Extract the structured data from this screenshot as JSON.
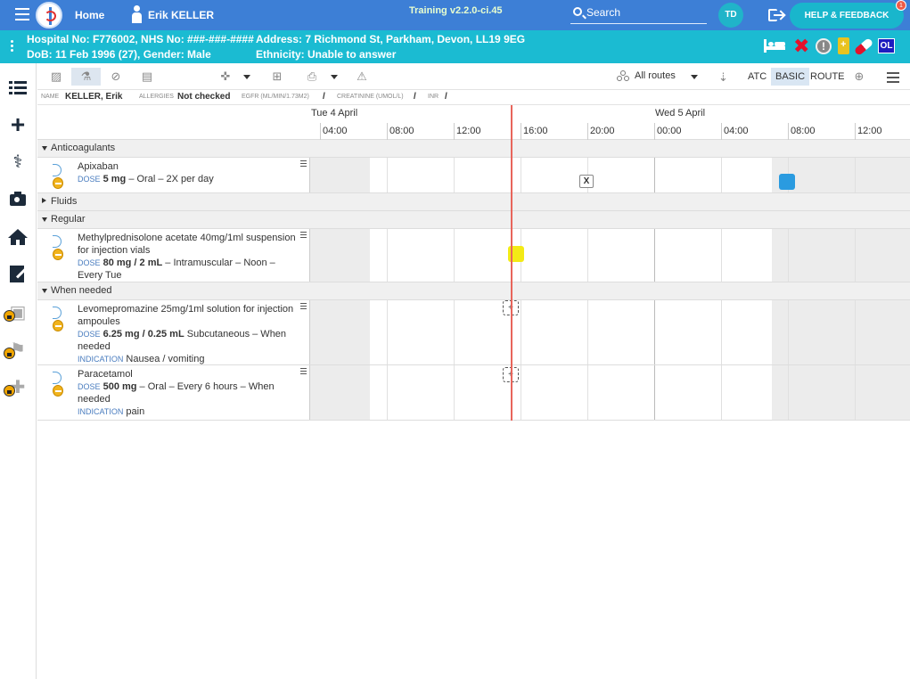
{
  "topbar": {
    "home_label": "Home",
    "user_name": "Erik KELLER",
    "training": "Training v2.2.0-ci.45",
    "search_label": "Search",
    "initials": "TD",
    "help_label": "HELP & FEEDBACK",
    "notification_count": "1"
  },
  "patient": {
    "hospital_line": "Hospital No: F776002, NHS No: ###-###-####",
    "dob_line": "DoB: 11 Feb 1996 (27), Gender: Male",
    "address_line": "Address: 7 Richmond St, Parkham, Devon, LL19 9EG",
    "ethnicity_line": "Ethnicity: Unable to answer",
    "ol_badge": "OL"
  },
  "toolbar": {
    "routes_label": "All routes",
    "atc_label": "ATC",
    "basic_label": "BASIC",
    "route_label": "ROUTE"
  },
  "infostrip": {
    "name_label": "NAME",
    "name_value": "KELLER, Erik",
    "allergies_label": "ALLERGIES",
    "allergies_value": "Not checked",
    "egfr_label": "EGFR (ML/MIN/1.73M2)",
    "egfr_value": "/",
    "creatinine_label": "CREATININE (UMOL/L)",
    "creatinine_value": "/",
    "inr_label": "INR",
    "inr_value": "/"
  },
  "timeline": {
    "days": [
      "Tue 4 April",
      "Wed 5 April"
    ],
    "times": [
      "04:00",
      "08:00",
      "12:00",
      "16:00",
      "20:00",
      "00:00",
      "04:00",
      "08:00",
      "12:00"
    ]
  },
  "sections": {
    "anticoagulants": "Anticoagulants",
    "fluids": "Fluids",
    "regular": "Regular",
    "when_needed": "When needed"
  },
  "meds": {
    "apixaban": {
      "name": "Apixaban",
      "dose_label": "DOSE",
      "dose": "5 mg",
      "detail": " – Oral – 2X per day",
      "marker": "X"
    },
    "methylpred": {
      "name": "Methylprednisolone acetate 40mg/1ml suspension for injection vials",
      "dose_label": "DOSE",
      "dose": "80 mg / 2 mL",
      "detail": " – Intramuscular – Noon – Every Tue"
    },
    "levomeprom": {
      "name": "Levomepromazine 25mg/1ml solution for injection ampoules",
      "dose_label": "DOSE",
      "dose": "6.25 mg / 0.25 mL",
      "detail": " Subcutaneous – When needed",
      "indication_label": "INDICATION",
      "indication": " Nausea / vomiting",
      "marker": "+"
    },
    "paracetamol": {
      "name": "Paracetamol",
      "dose_label": "DOSE",
      "dose": "500 mg",
      "detail": " – Oral – Every 6 hours – When needed",
      "indication_label": "INDICATION",
      "indication": " pain",
      "marker": "+"
    }
  }
}
